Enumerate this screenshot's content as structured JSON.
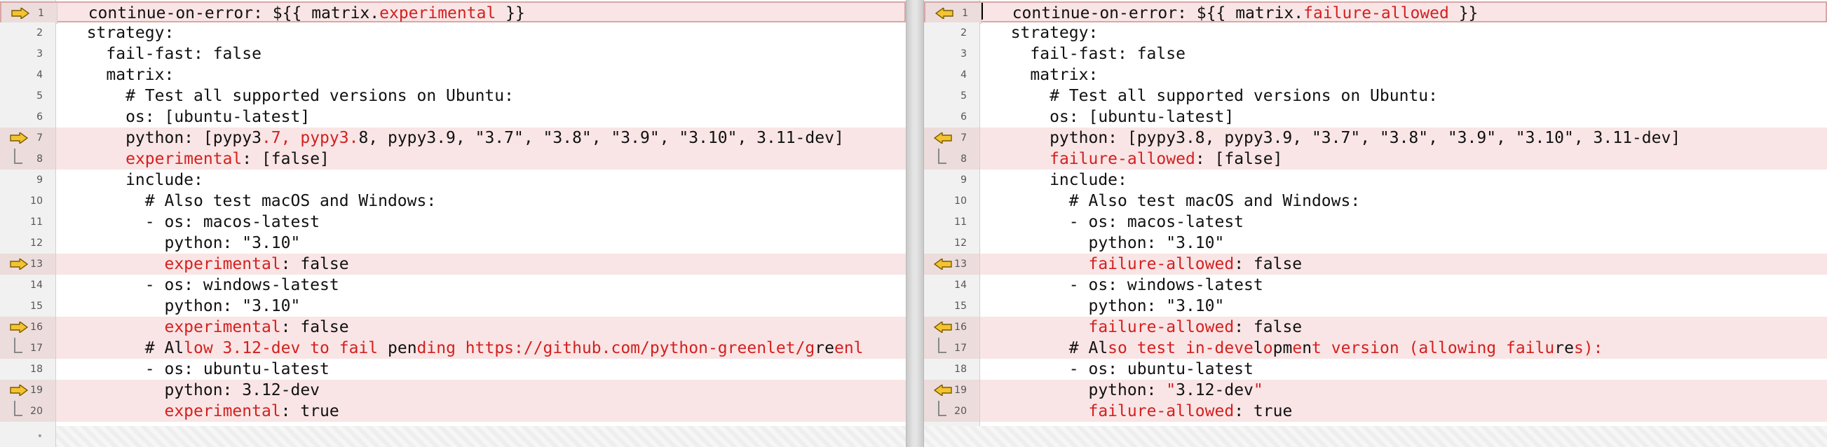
{
  "left": {
    "lines": [
      {
        "no": "1",
        "changed": true,
        "arrow": true,
        "bracket": false,
        "indent": "  ",
        "segs": [
          {
            "t": "continue-on-error: ${{ matrix.",
            "h": false
          },
          {
            "t": "experimental",
            "h": true
          },
          {
            "t": " }}",
            "h": false
          }
        ]
      },
      {
        "no": "2",
        "changed": false,
        "arrow": false,
        "bracket": false,
        "indent": "",
        "segs": [
          {
            "t": "  strategy:",
            "h": false
          }
        ]
      },
      {
        "no": "3",
        "changed": false,
        "arrow": false,
        "bracket": false,
        "indent": "",
        "segs": [
          {
            "t": "    fail-fast: false",
            "h": false
          }
        ]
      },
      {
        "no": "4",
        "changed": false,
        "arrow": false,
        "bracket": false,
        "indent": "",
        "segs": [
          {
            "t": "    matrix:",
            "h": false
          }
        ]
      },
      {
        "no": "5",
        "changed": false,
        "arrow": false,
        "bracket": false,
        "indent": "",
        "segs": [
          {
            "t": "      # Test all supported versions on Ubuntu:",
            "h": false
          }
        ]
      },
      {
        "no": "6",
        "changed": false,
        "arrow": false,
        "bracket": false,
        "indent": "",
        "segs": [
          {
            "t": "      os: [ubuntu-latest]",
            "h": false
          }
        ]
      },
      {
        "no": "7",
        "changed": true,
        "arrow": true,
        "bracket": false,
        "indent": "",
        "segs": [
          {
            "t": "      python: [pypy3",
            "h": false
          },
          {
            "t": ".7, pypy3.",
            "h": true
          },
          {
            "t": "8, pypy3.9, \"3.7\", \"3.8\", \"3.9\", \"3.10\", 3.11-dev]",
            "h": false
          }
        ]
      },
      {
        "no": "8",
        "changed": true,
        "arrow": false,
        "bracket": true,
        "indent": "",
        "segs": [
          {
            "t": "      ",
            "h": false
          },
          {
            "t": "experimental",
            "h": true
          },
          {
            "t": ": [false]",
            "h": false
          }
        ]
      },
      {
        "no": "9",
        "changed": false,
        "arrow": false,
        "bracket": false,
        "indent": "",
        "segs": [
          {
            "t": "      include:",
            "h": false
          }
        ]
      },
      {
        "no": "10",
        "changed": false,
        "arrow": false,
        "bracket": false,
        "indent": "",
        "segs": [
          {
            "t": "        # Also test macOS and Windows:",
            "h": false
          }
        ]
      },
      {
        "no": "11",
        "changed": false,
        "arrow": false,
        "bracket": false,
        "indent": "",
        "segs": [
          {
            "t": "        - os: macos-latest",
            "h": false
          }
        ]
      },
      {
        "no": "12",
        "changed": false,
        "arrow": false,
        "bracket": false,
        "indent": "",
        "segs": [
          {
            "t": "          python: \"3.10\"",
            "h": false
          }
        ]
      },
      {
        "no": "13",
        "changed": true,
        "arrow": true,
        "bracket": false,
        "indent": "",
        "segs": [
          {
            "t": "          ",
            "h": false
          },
          {
            "t": "experimental",
            "h": true
          },
          {
            "t": ": false",
            "h": false
          }
        ]
      },
      {
        "no": "14",
        "changed": false,
        "arrow": false,
        "bracket": false,
        "indent": "",
        "segs": [
          {
            "t": "        - os: windows-latest",
            "h": false
          }
        ]
      },
      {
        "no": "15",
        "changed": false,
        "arrow": false,
        "bracket": false,
        "indent": "",
        "segs": [
          {
            "t": "          python: \"3.10\"",
            "h": false
          }
        ]
      },
      {
        "no": "16",
        "changed": true,
        "arrow": true,
        "bracket": false,
        "indent": "",
        "segs": [
          {
            "t": "          ",
            "h": false
          },
          {
            "t": "experimental",
            "h": true
          },
          {
            "t": ": false",
            "h": false
          }
        ]
      },
      {
        "no": "17",
        "changed": true,
        "arrow": false,
        "bracket": true,
        "indent": "",
        "segs": [
          {
            "t": "        # Al",
            "h": false
          },
          {
            "t": "low 3.12-dev",
            "h": true
          },
          {
            "t": " ",
            "h": false
          },
          {
            "t": "to",
            "h": true
          },
          {
            "t": " ",
            "h": false
          },
          {
            "t": "fail",
            "h": true
          },
          {
            "t": " pen",
            "h": false
          },
          {
            "t": "ding https://github.com/python-greenlet/g",
            "h": true
          },
          {
            "t": "re",
            "h": false
          },
          {
            "t": "enl",
            "h": true
          }
        ]
      },
      {
        "no": "18",
        "changed": false,
        "arrow": false,
        "bracket": false,
        "indent": "",
        "segs": [
          {
            "t": "        - os: ubuntu-latest",
            "h": false
          }
        ]
      },
      {
        "no": "19",
        "changed": true,
        "arrow": true,
        "bracket": false,
        "indent": "",
        "segs": [
          {
            "t": "          python: 3.12-dev",
            "h": false
          }
        ]
      },
      {
        "no": "20",
        "changed": true,
        "arrow": false,
        "bracket": true,
        "indent": "",
        "segs": [
          {
            "t": "          ",
            "h": false
          },
          {
            "t": "experimental",
            "h": true
          },
          {
            "t": ": true",
            "h": false
          }
        ]
      }
    ],
    "end_marker": "•"
  },
  "right": {
    "lines": [
      {
        "no": "1",
        "changed": true,
        "arrow": true,
        "bracket": false,
        "indent": "  ",
        "segs": [
          {
            "t": "continue-on-error: ${{ matrix.",
            "h": false
          },
          {
            "t": "failure-allowed",
            "h": true
          },
          {
            "t": " }}",
            "h": false
          }
        ]
      },
      {
        "no": "2",
        "changed": false,
        "arrow": false,
        "bracket": false,
        "indent": "",
        "segs": [
          {
            "t": "  strategy:",
            "h": false
          }
        ]
      },
      {
        "no": "3",
        "changed": false,
        "arrow": false,
        "bracket": false,
        "indent": "",
        "segs": [
          {
            "t": "    fail-fast: false",
            "h": false
          }
        ]
      },
      {
        "no": "4",
        "changed": false,
        "arrow": false,
        "bracket": false,
        "indent": "",
        "segs": [
          {
            "t": "    matrix:",
            "h": false
          }
        ]
      },
      {
        "no": "5",
        "changed": false,
        "arrow": false,
        "bracket": false,
        "indent": "",
        "segs": [
          {
            "t": "      # Test all supported versions on Ubuntu:",
            "h": false
          }
        ]
      },
      {
        "no": "6",
        "changed": false,
        "arrow": false,
        "bracket": false,
        "indent": "",
        "segs": [
          {
            "t": "      os: [ubuntu-latest]",
            "h": false
          }
        ]
      },
      {
        "no": "7",
        "changed": true,
        "arrow": true,
        "bracket": false,
        "indent": "",
        "segs": [
          {
            "t": "      python: [pypy3.8, pypy3.9, \"3.7\", \"3.8\", \"3.9\", \"3.10\", 3.11-dev]",
            "h": false
          }
        ]
      },
      {
        "no": "8",
        "changed": true,
        "arrow": false,
        "bracket": true,
        "indent": "",
        "segs": [
          {
            "t": "      ",
            "h": false
          },
          {
            "t": "failure-allowed",
            "h": true
          },
          {
            "t": ": [false]",
            "h": false
          }
        ]
      },
      {
        "no": "9",
        "changed": false,
        "arrow": false,
        "bracket": false,
        "indent": "",
        "segs": [
          {
            "t": "      include:",
            "h": false
          }
        ]
      },
      {
        "no": "10",
        "changed": false,
        "arrow": false,
        "bracket": false,
        "indent": "",
        "segs": [
          {
            "t": "        # Also test macOS and Windows:",
            "h": false
          }
        ]
      },
      {
        "no": "11",
        "changed": false,
        "arrow": false,
        "bracket": false,
        "indent": "",
        "segs": [
          {
            "t": "        - os: macos-latest",
            "h": false
          }
        ]
      },
      {
        "no": "12",
        "changed": false,
        "arrow": false,
        "bracket": false,
        "indent": "",
        "segs": [
          {
            "t": "          python: \"3.10\"",
            "h": false
          }
        ]
      },
      {
        "no": "13",
        "changed": true,
        "arrow": true,
        "bracket": false,
        "indent": "",
        "segs": [
          {
            "t": "          ",
            "h": false
          },
          {
            "t": "failure-allowed",
            "h": true
          },
          {
            "t": ": false",
            "h": false
          }
        ]
      },
      {
        "no": "14",
        "changed": false,
        "arrow": false,
        "bracket": false,
        "indent": "",
        "segs": [
          {
            "t": "        - os: windows-latest",
            "h": false
          }
        ]
      },
      {
        "no": "15",
        "changed": false,
        "arrow": false,
        "bracket": false,
        "indent": "",
        "segs": [
          {
            "t": "          python: \"3.10\"",
            "h": false
          }
        ]
      },
      {
        "no": "16",
        "changed": true,
        "arrow": true,
        "bracket": false,
        "indent": "",
        "segs": [
          {
            "t": "          ",
            "h": false
          },
          {
            "t": "failure-allowed",
            "h": true
          },
          {
            "t": ": false",
            "h": false
          }
        ]
      },
      {
        "no": "17",
        "changed": true,
        "arrow": false,
        "bracket": true,
        "indent": "",
        "segs": [
          {
            "t": "        # Al",
            "h": false
          },
          {
            "t": "so test",
            "h": true
          },
          {
            "t": " ",
            "h": false
          },
          {
            "t": "in-deve",
            "h": true
          },
          {
            "t": "l",
            "h": false
          },
          {
            "t": "o",
            "h": true
          },
          {
            "t": "pm",
            "h": false
          },
          {
            "t": "e",
            "h": true
          },
          {
            "t": "n",
            "h": false
          },
          {
            "t": "t version (allowing failu",
            "h": true
          },
          {
            "t": "re",
            "h": false
          },
          {
            "t": "s):",
            "h": true
          }
        ]
      },
      {
        "no": "18",
        "changed": false,
        "arrow": false,
        "bracket": false,
        "indent": "",
        "segs": [
          {
            "t": "        - os: ubuntu-latest",
            "h": false
          }
        ]
      },
      {
        "no": "19",
        "changed": true,
        "arrow": true,
        "bracket": false,
        "indent": "",
        "segs": [
          {
            "t": "          python: ",
            "h": false
          },
          {
            "t": "\"",
            "h": true
          },
          {
            "t": "3.12-dev",
            "h": false
          },
          {
            "t": "\"",
            "h": true
          }
        ]
      },
      {
        "no": "20",
        "changed": true,
        "arrow": false,
        "bracket": true,
        "indent": "",
        "segs": [
          {
            "t": "          ",
            "h": false
          },
          {
            "t": "failure-allowed",
            "h": true
          },
          {
            "t": ": true",
            "h": false
          }
        ]
      }
    ]
  },
  "colors": {
    "changed_bg": "#f9e5e5",
    "highlight": "#d42020",
    "arrow_fill": "#f4c430"
  }
}
